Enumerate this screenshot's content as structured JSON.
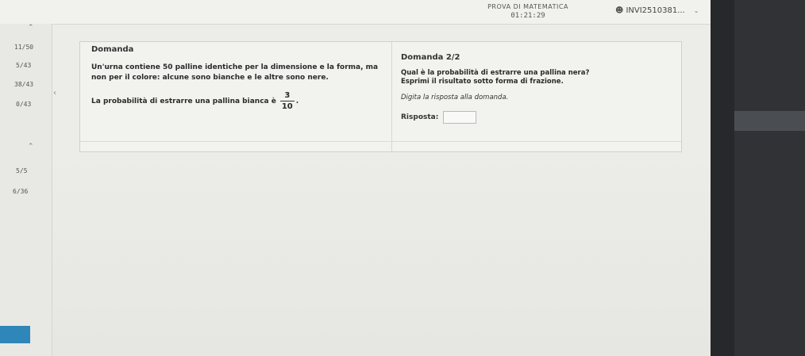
{
  "header": {
    "exam_title": "PROVA DI MATEMATICA",
    "timer": "01:21:29",
    "user_id": "INVI2510381...",
    "user_icon": "user-icon",
    "caret_icon": "chevron-down-icon"
  },
  "sidebar": {
    "section1_counters": [
      "11/50",
      "5/43",
      "38/43",
      "0/43"
    ],
    "section2_counters": [
      "5/5",
      "6/36"
    ]
  },
  "question": {
    "label": "Domanda",
    "text": "Un'urna contiene 50 palline identiche per la dimensione e la forma, ma non per il colore: alcune sono bianche e le altre sono nere.",
    "prob_text": "La probabilità di estrarre una pallina bianca è",
    "fraction": {
      "numerator": "3",
      "denominator": "10"
    },
    "period": "."
  },
  "subquestion": {
    "label": "Domanda 2/2",
    "text_line1": "Qual è la probabilità di estrarre una pallina nera?",
    "text_line2": "Esprimi il risultato sotto forma di frazione.",
    "hint": "Digita la risposta alla domanda.",
    "answer_label": "Risposta:",
    "answer_value": ""
  },
  "colors": {
    "accent_blue": "#2f86b8"
  }
}
